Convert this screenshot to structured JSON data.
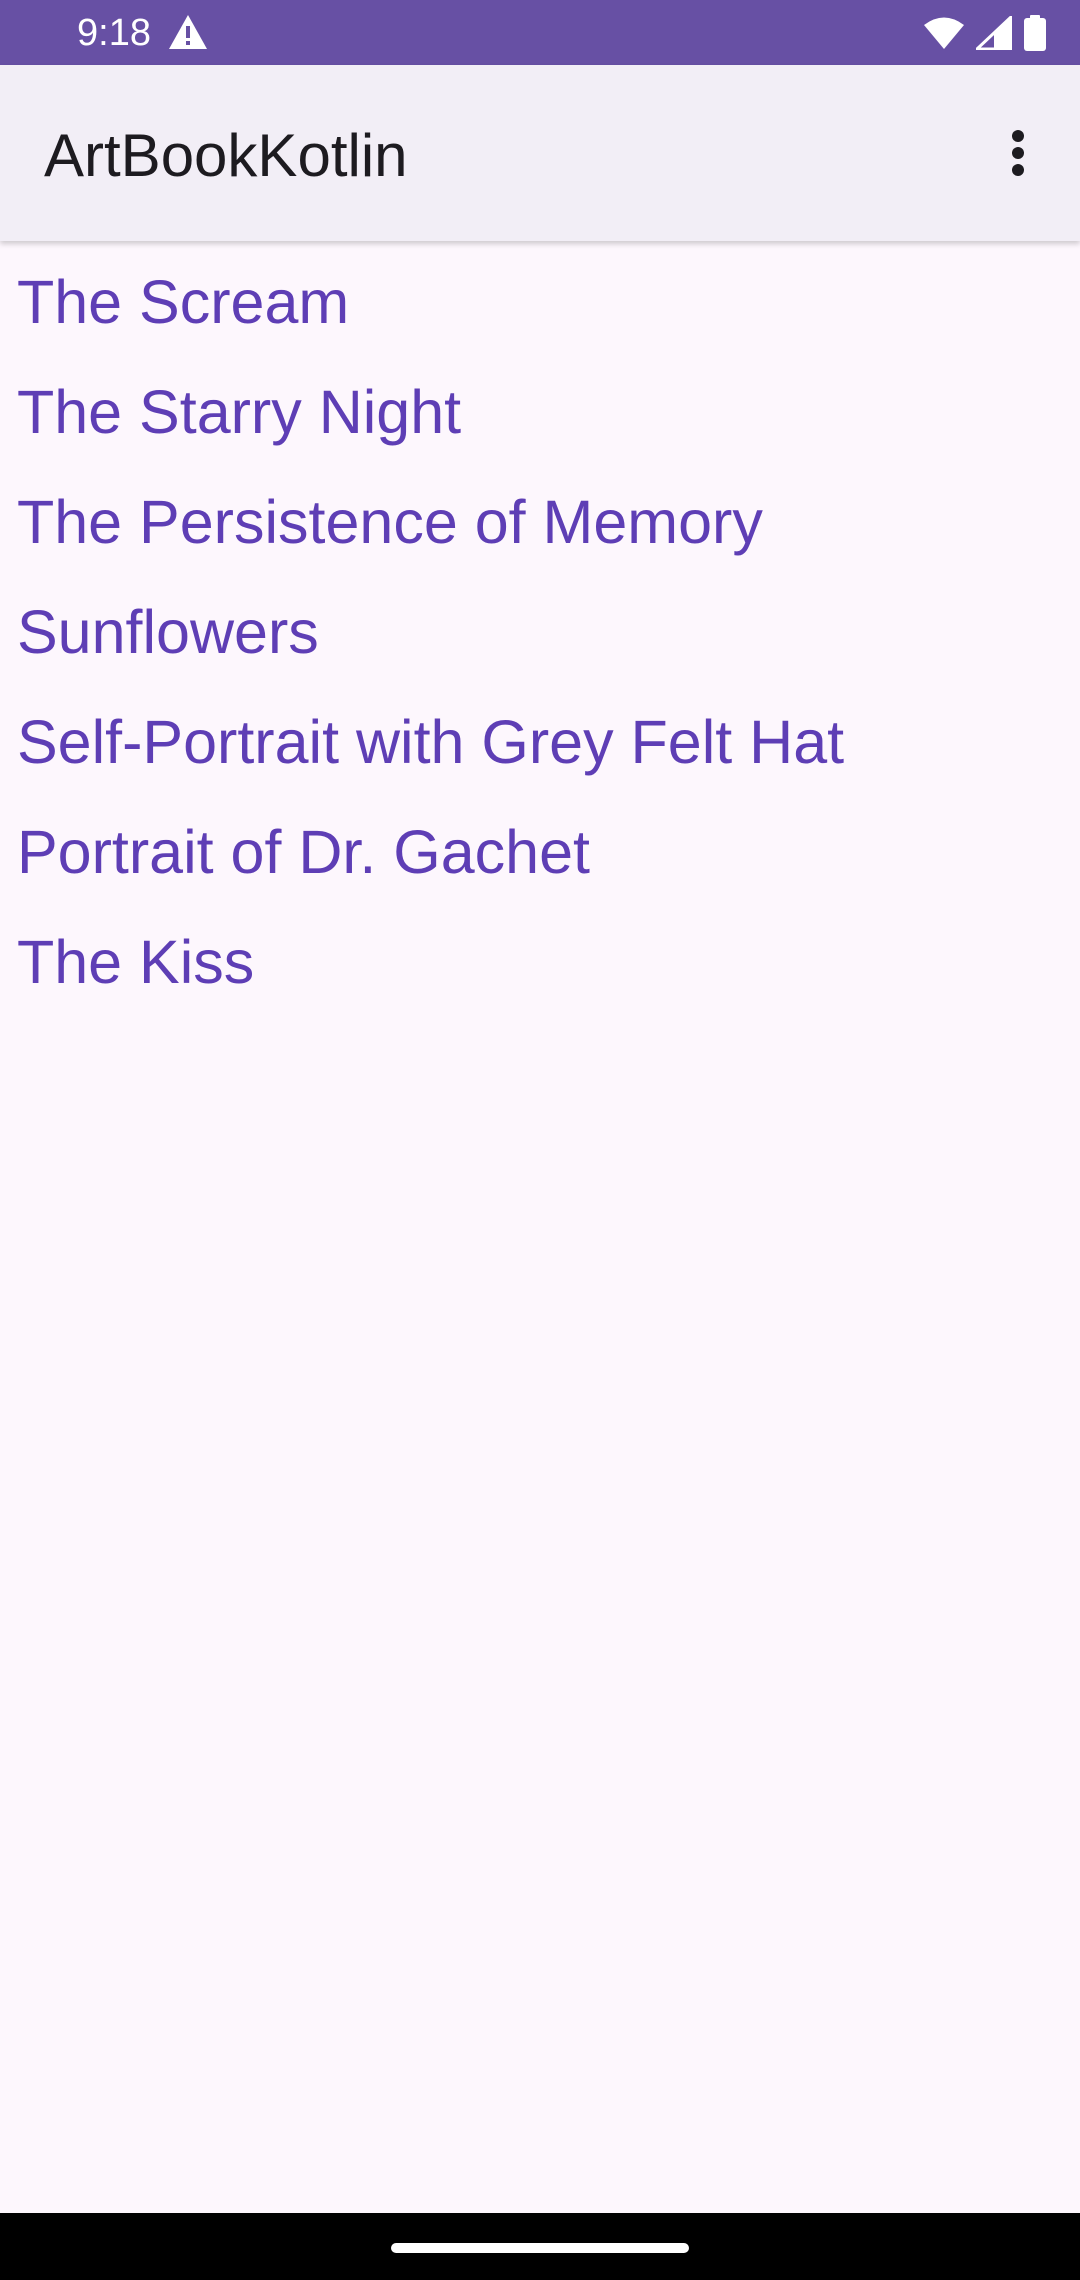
{
  "status_bar": {
    "time": "9:18",
    "background": "#6750A4",
    "icons": [
      "warning-icon",
      "wifi-icon",
      "cell-signal-icon",
      "battery-icon"
    ]
  },
  "app_bar": {
    "title": "ArtBookKotlin",
    "background": "#F2EEF6",
    "menu_icon": "more-vert-icon"
  },
  "art_list": {
    "text_color": "#5E3EB5",
    "items": [
      {
        "name": "The Scream"
      },
      {
        "name": "The Starry Night"
      },
      {
        "name": "The Persistence of Memory"
      },
      {
        "name": "Sunflowers"
      },
      {
        "name": "Self-Portrait with Grey Felt Hat"
      },
      {
        "name": "Portrait of Dr. Gachet"
      },
      {
        "name": "The Kiss"
      }
    ]
  },
  "page": {
    "background": "#FDF7FD"
  }
}
